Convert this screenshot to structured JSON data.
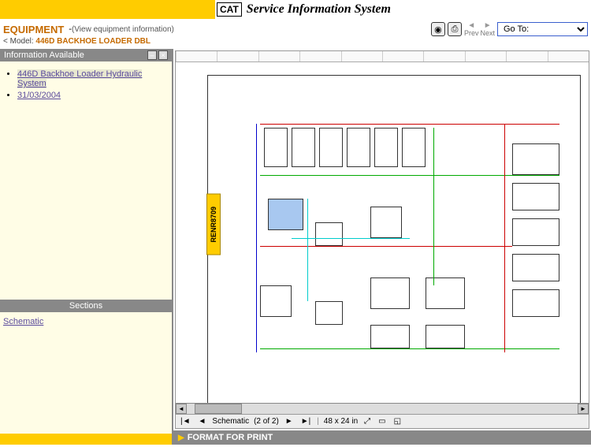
{
  "header": {
    "logo_text": "CAT",
    "title": "Service Information System"
  },
  "equipment": {
    "label": "EQUIPMENT",
    "info_link": "(View equipment information)",
    "model_prefix": "< Model:",
    "model_value": "446D BACKHOE LOADER DBL"
  },
  "nav": {
    "prev_label": "Prev",
    "next_label": "Next",
    "goto_label": "Go To:"
  },
  "sidebar": {
    "panel_title": "Information Available",
    "items": [
      {
        "label": "446D Backhoe Loader Hydraulic System",
        "selected": true
      },
      {
        "label": "31/03/2004",
        "selected": false
      }
    ],
    "sections_title": "Sections",
    "sections": [
      {
        "label": "Schematic"
      }
    ]
  },
  "viewer": {
    "doc_code": "RENR8709",
    "status_label": "Schematic",
    "page_info": "(2 of 2)",
    "dimensions": "48 x 24 in"
  },
  "footer": {
    "format_print": "FORMAT FOR PRINT"
  }
}
